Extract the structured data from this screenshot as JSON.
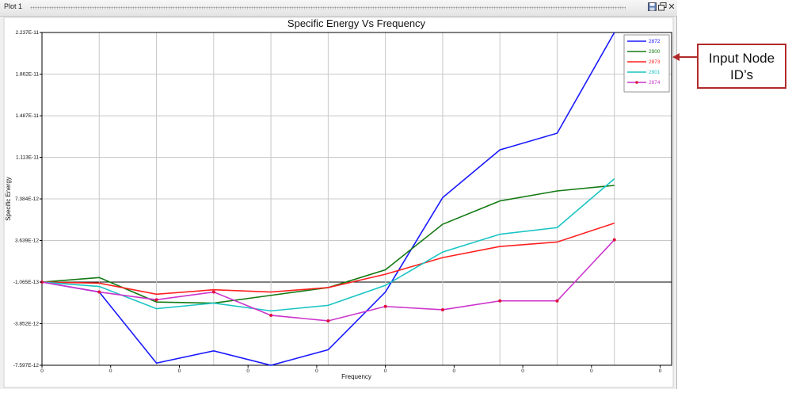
{
  "window": {
    "title": "Plot 1",
    "controls": [
      "save-icon",
      "restore-icon",
      "close-icon"
    ]
  },
  "callout": {
    "text": "Input Node ID’s",
    "border_color": "#b22a2a"
  },
  "chart_data": {
    "type": "line",
    "title": "Specific Energy Vs Frequency",
    "xlabel": "Frequency",
    "ylabel": "Specific Energy",
    "x_tick_labels": [
      "0",
      "0",
      "0",
      "0",
      "0",
      "0",
      "0",
      "0",
      "0",
      "0"
    ],
    "x": [
      0,
      1,
      2,
      3,
      4,
      5,
      6,
      7,
      8,
      9,
      10,
      11
    ],
    "xlim": [
      0,
      11
    ],
    "y_tick_labels": [
      "-7.597E-12",
      "-3.852E-12",
      "-1.065E-13",
      "3.639E-12",
      "7.384E-12",
      "1.113E-11",
      "1.487E-11",
      "1.862E-11",
      "2.237E-11"
    ],
    "y_tick_values": [
      -7.597e-12,
      -3.852e-12,
      -1.065e-13,
      3.639e-12,
      7.384e-12,
      1.113e-11,
      1.487e-11,
      1.862e-11,
      2.237e-11
    ],
    "ylim": [
      -7.597e-12,
      2.237e-11
    ],
    "grid": true,
    "legend_position": "top-right",
    "series": [
      {
        "name": "2872",
        "color": "#1a1aff",
        "markers": false,
        "values": [
          -1.065e-13,
          -1e-12,
          -7.4e-12,
          -6.3e-12,
          -7.6e-12,
          -6.2e-12,
          -1e-12,
          7.5e-12,
          1.18e-11,
          1.33e-11,
          2.237e-11
        ]
      },
      {
        "name": "2900",
        "color": "#137a13",
        "markers": false,
        "values": [
          -1.065e-13,
          3e-13,
          -1.9e-12,
          -2e-12,
          -1.3e-12,
          -6e-13,
          1e-12,
          5.1e-12,
          7.2e-12,
          8.1e-12,
          8.6e-12
        ]
      },
      {
        "name": "2873",
        "color": "#ff2020",
        "markers": false,
        "values": [
          -1.065e-13,
          -2e-13,
          -1.2e-12,
          -8e-13,
          -1e-12,
          -6e-13,
          6e-13,
          2.1e-12,
          3.1e-12,
          3.5e-12,
          5.2e-12
        ]
      },
      {
        "name": "2901",
        "color": "#1ac4c4",
        "markers": false,
        "values": [
          -1.065e-13,
          -5e-13,
          -2.5e-12,
          -2e-12,
          -2.7e-12,
          -2.2e-12,
          -4e-13,
          2.6e-12,
          4.2e-12,
          4.8e-12,
          9.2e-12
        ]
      },
      {
        "name": "2874",
        "color": "#cc33cc",
        "markers": true,
        "values": [
          -1.065e-13,
          -1e-12,
          -1.7e-12,
          -1e-12,
          -3.1e-12,
          -3.6e-12,
          -2.3e-12,
          -2.6e-12,
          -1.8e-12,
          -1.8e-12,
          3.7e-12
        ]
      }
    ]
  }
}
